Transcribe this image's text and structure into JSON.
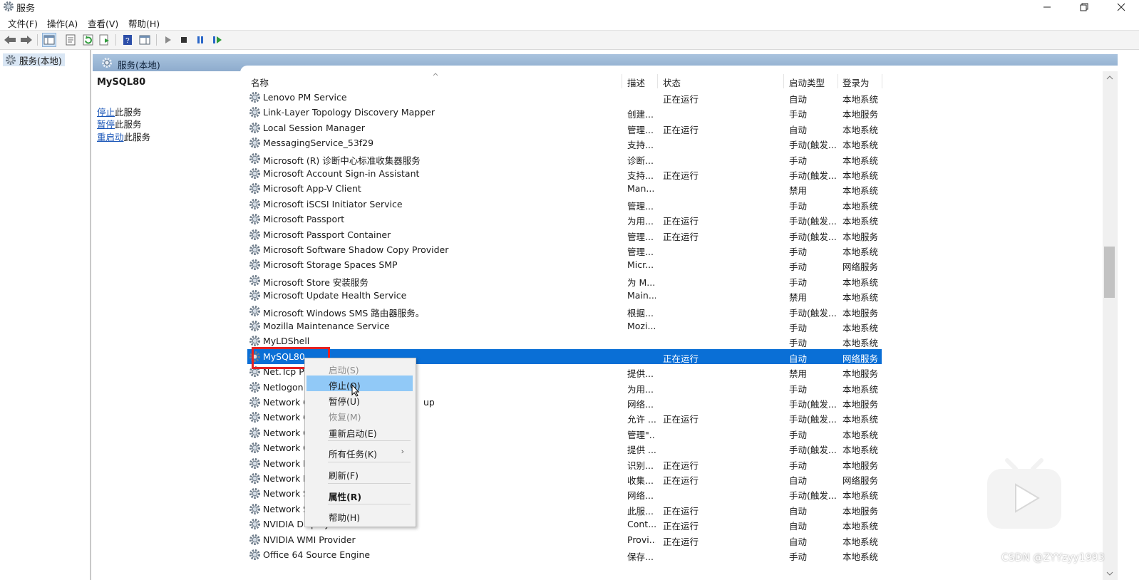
{
  "window": {
    "title": "服务"
  },
  "menubar": {
    "items": [
      "文件(F)",
      "操作(A)",
      "查看(V)",
      "帮助(H)"
    ]
  },
  "tree": {
    "root_label": "服务(本地)"
  },
  "panel": {
    "header_label": "服务(本地)"
  },
  "description": {
    "service_name": "MySQL80",
    "actions": [
      {
        "link": "停止",
        "suffix": "此服务"
      },
      {
        "link": "暂停",
        "suffix": "此服务"
      },
      {
        "link": "重启动",
        "suffix": "此服务"
      }
    ]
  },
  "list": {
    "columns": [
      "名称",
      "描述",
      "状态",
      "启动类型",
      "登录为"
    ],
    "rows": [
      {
        "name": "Lenovo PM Service",
        "desc": "",
        "status": "正在运行",
        "startup": "自动",
        "logon": "本地系统"
      },
      {
        "name": "Link-Layer Topology Discovery Mapper",
        "desc": "创建...",
        "status": "",
        "startup": "手动",
        "logon": "本地服务"
      },
      {
        "name": "Local Session Manager",
        "desc": "管理...",
        "status": "正在运行",
        "startup": "自动",
        "logon": "本地系统"
      },
      {
        "name": "MessagingService_53f29",
        "desc": "支持...",
        "status": "",
        "startup": "手动(触发...",
        "logon": "本地系统"
      },
      {
        "name": "Microsoft (R) 诊断中心标准收集器服务",
        "desc": "诊断...",
        "status": "",
        "startup": "手动",
        "logon": "本地系统"
      },
      {
        "name": "Microsoft Account Sign-in Assistant",
        "desc": "支持...",
        "status": "正在运行",
        "startup": "手动(触发...",
        "logon": "本地系统"
      },
      {
        "name": "Microsoft App-V Client",
        "desc": "Man...",
        "status": "",
        "startup": "禁用",
        "logon": "本地系统"
      },
      {
        "name": "Microsoft iSCSI Initiator Service",
        "desc": "管理...",
        "status": "",
        "startup": "手动",
        "logon": "本地系统"
      },
      {
        "name": "Microsoft Passport",
        "desc": "为用...",
        "status": "正在运行",
        "startup": "手动(触发...",
        "logon": "本地系统"
      },
      {
        "name": "Microsoft Passport Container",
        "desc": "管理...",
        "status": "正在运行",
        "startup": "手动(触发...",
        "logon": "本地服务"
      },
      {
        "name": "Microsoft Software Shadow Copy Provider",
        "desc": "管理...",
        "status": "",
        "startup": "手动",
        "logon": "本地系统"
      },
      {
        "name": "Microsoft Storage Spaces SMP",
        "desc": "Micr...",
        "status": "",
        "startup": "手动",
        "logon": "网络服务"
      },
      {
        "name": "Microsoft Store 安装服务",
        "desc": "为 M...",
        "status": "",
        "startup": "手动",
        "logon": "本地系统"
      },
      {
        "name": "Microsoft Update Health Service",
        "desc": "Main...",
        "status": "",
        "startup": "禁用",
        "logon": "本地系统"
      },
      {
        "name": "Microsoft Windows SMS 路由器服务。",
        "desc": "根据...",
        "status": "",
        "startup": "手动(触发...",
        "logon": "本地服务"
      },
      {
        "name": "Mozilla Maintenance Service",
        "desc": "Mozi...",
        "status": "",
        "startup": "手动",
        "logon": "本地系统"
      },
      {
        "name": "MyLDShell",
        "desc": "",
        "status": "",
        "startup": "手动",
        "logon": "本地系统"
      },
      {
        "name": "MySQL80",
        "desc": "",
        "status": "正在运行",
        "startup": "自动",
        "logon": "网络服务",
        "selected": true
      },
      {
        "name": "Net.Tcp P",
        "desc": "提供...",
        "status": "",
        "startup": "禁用",
        "logon": "本地服务"
      },
      {
        "name": "Netlogon",
        "desc": "为用...",
        "status": "",
        "startup": "手动",
        "logon": "本地系统"
      },
      {
        "name": "Network C",
        "name_tail": "up",
        "desc": "网络...",
        "status": "",
        "startup": "手动(触发...",
        "logon": "本地服务"
      },
      {
        "name": "Network C",
        "desc": "允许 ...",
        "status": "正在运行",
        "startup": "手动(触发...",
        "logon": "本地系统"
      },
      {
        "name": "Network C",
        "desc": "管理\"...",
        "status": "",
        "startup": "手动",
        "logon": "本地系统"
      },
      {
        "name": "Network C",
        "desc": "提供 ...",
        "status": "",
        "startup": "手动(触发...",
        "logon": "本地系统"
      },
      {
        "name": "Network L",
        "desc": "识别...",
        "status": "正在运行",
        "startup": "手动",
        "logon": "本地服务"
      },
      {
        "name": "Network L",
        "desc": "收集...",
        "status": "正在运行",
        "startup": "自动",
        "logon": "网络服务"
      },
      {
        "name": "Network S",
        "desc": "网络...",
        "status": "",
        "startup": "手动(触发...",
        "logon": "本地系统"
      },
      {
        "name": "Network S",
        "desc": "此服...",
        "status": "正在运行",
        "startup": "自动",
        "logon": "本地服务"
      },
      {
        "name": "NVIDIA Display Container LS",
        "desc": "Cont...",
        "status": "正在运行",
        "startup": "自动",
        "logon": "本地系统"
      },
      {
        "name": "NVIDIA WMI Provider",
        "desc": "Provi...",
        "status": "正在运行",
        "startup": "自动",
        "logon": "本地系统"
      },
      {
        "name": "Office 64 Source Engine",
        "desc": "保存...",
        "status": "",
        "startup": "手动",
        "logon": "本地系统"
      }
    ]
  },
  "context_menu": {
    "items": [
      {
        "label": "启动(S)",
        "disabled": true
      },
      {
        "label": "停止(O)",
        "highlighted": true
      },
      {
        "label": "暂停(U)"
      },
      {
        "label": "恢复(M)",
        "disabled": true
      },
      {
        "label": "重新启动(E)"
      },
      {
        "label": "所有任务(K)",
        "submenu": true
      },
      {
        "label": "刷新(F)"
      },
      {
        "label": "属性(R)",
        "bold": true
      },
      {
        "label": "帮助(H)"
      }
    ]
  },
  "watermark": "CSDN @ZYYzyy1993",
  "colors": {
    "selection": "#0a6fd6",
    "panel_header": "#a9c3de",
    "highlight_box": "#e52222",
    "menu_hover": "#91c9f7"
  }
}
